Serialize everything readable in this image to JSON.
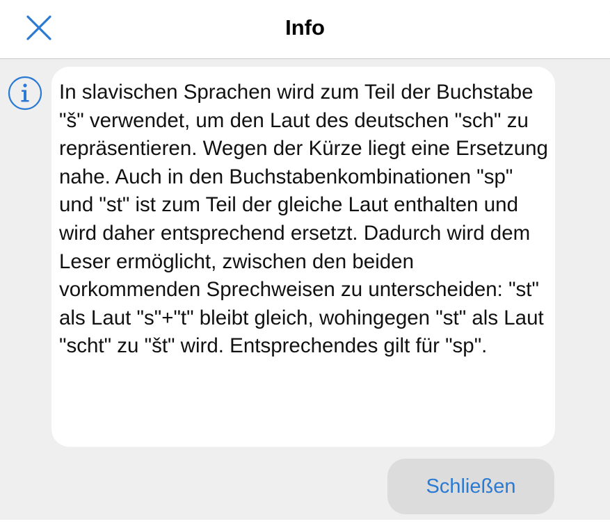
{
  "dialog": {
    "title": "Info",
    "close_icon": "close-icon",
    "info_icon": "info-icon",
    "message": "In slavischen Sprachen wird zum Teil der Buchstabe \"š\" verwendet, um den Laut des deutschen \"sch\" zu repräsentieren. Wegen der Kürze liegt eine Ersetzung nahe. Auch in den Buchstabenkombinationen \"sp\" und \"st\" ist zum Teil der gleiche Laut enthalten und wird daher entsprechend ersetzt. Dadurch wird dem Leser ermöglicht, zwischen den beiden vorkommenden Sprechweisen zu unterscheiden: \"st\" als Laut \"s\"+\"t\" bleibt gleich, wohingegen \"st\" als Laut \"scht\" zu \"št\" wird. Entsprechendes gilt für \"sp\".",
    "close_button_label": "Schließen"
  },
  "colors": {
    "accent": "#2a7ad3",
    "background": "#efeff0",
    "card": "#ffffff",
    "button_background": "#dcdcdd"
  }
}
